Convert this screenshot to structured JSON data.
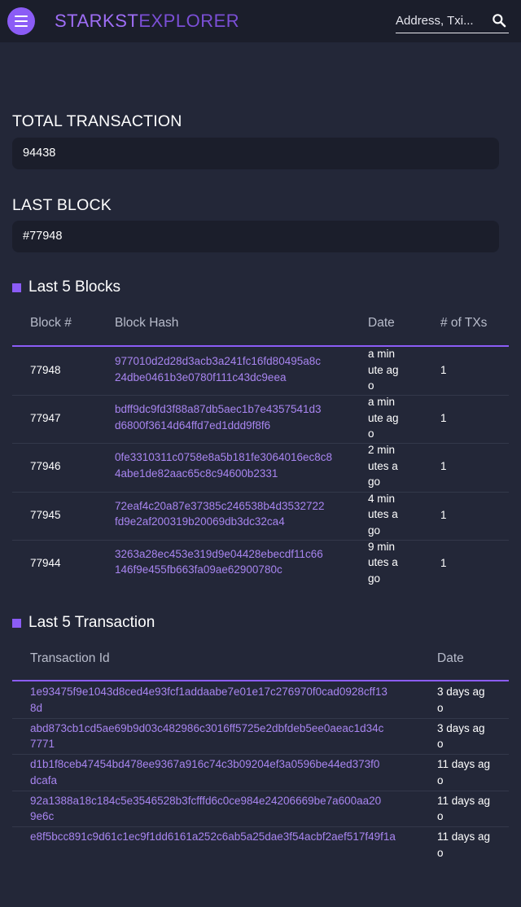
{
  "header": {
    "brand_part1": "STARKST",
    "brand_part2": "EXPLORER",
    "search_placeholder": "Address, Txi..."
  },
  "stats": {
    "total_transaction_label": "TOTAL TRANSACTION",
    "total_transaction_value": "94438",
    "last_block_label": "LAST BLOCK",
    "last_block_value": "#77948"
  },
  "blocks": {
    "title": "Last 5 Blocks",
    "columns": [
      "Block #",
      "Block Hash",
      "Date",
      "# of TXs"
    ],
    "rows": [
      {
        "number": "77948",
        "hash_line1": "977010d2d28d3acb3a241fc16fd80495a8c",
        "hash_line2": "24dbe0461b3e0780f111c43dc9eea",
        "date_l1": "a min",
        "date_l2": "ute ag",
        "date_l3": "o",
        "txs": "1"
      },
      {
        "number": "77947",
        "hash_line1": "bdff9dc9fd3f88a87db5aec1b7e4357541d3",
        "hash_line2": "d6800f3614d64ffd7ed1ddd9f8f6",
        "date_l1": "a min",
        "date_l2": "ute ag",
        "date_l3": "o",
        "txs": "1"
      },
      {
        "number": "77946",
        "hash_line1": "0fe3310311c0758e8a5b181fe3064016ec8c8",
        "hash_line2": "4abe1de82aac65c8c94600b2331",
        "date_l1": "2 min",
        "date_l2": "utes a",
        "date_l3": "go",
        "txs": "1"
      },
      {
        "number": "77945",
        "hash_line1": "72eaf4c20a87e37385c246538b4d3532722",
        "hash_line2": "fd9e2af200319b20069db3dc32ca4",
        "date_l1": "4 min",
        "date_l2": "utes a",
        "date_l3": "go",
        "txs": "1"
      },
      {
        "number": "77944",
        "hash_line1": "3263a28ec453e319d9e04428ebecdf11c66",
        "hash_line2": "146f9e455fb663fa09ae62900780c",
        "date_l1": "9 min",
        "date_l2": "utes a",
        "date_l3": "go",
        "txs": "1"
      }
    ]
  },
  "transactions": {
    "title": "Last 5 Transaction",
    "columns": [
      "Transaction Id",
      "Date"
    ],
    "rows": [
      {
        "id_line1": "1e93475f9e1043d8ced4e93fcf1addaabe7e01e17c276970f0cad0928cff13",
        "id_line2": "8d",
        "date_l1": "3 days ag",
        "date_l2": "o"
      },
      {
        "id_line1": "abd873cb1cd5ae69b9d03c482986c3016ff5725e2dbfdeb5ee0aeac1d34c",
        "id_line2": "7771",
        "date_l1": "3 days ag",
        "date_l2": "o"
      },
      {
        "id_line1": "d1b1f8ceb47454bd478ee9367a916c74c3b09204ef3a0596be44ed373f0",
        "id_line2": "dcafa",
        "date_l1": "11 days ag",
        "date_l2": "o"
      },
      {
        "id_line1": "92a1388a18c184c5e3546528b3fcfffd6c0ce984e24206669be7a600aa20",
        "id_line2": "9e6c",
        "date_l1": "11 days ag",
        "date_l2": "o"
      },
      {
        "id_line1": "e8f5bcc891c9d61c1ec9f1dd6161a252c6ab5a25dae3f54acbf2aef517f49f1a",
        "id_line2": "",
        "date_l1": "11 days ag",
        "date_l2": "o"
      }
    ]
  },
  "colors": {
    "accent": "#8b5cf6",
    "background": "#232738",
    "panel": "#1b1e2b",
    "link": "#a885f0"
  },
  "icons": {
    "menu": "menu-icon",
    "search": "search-icon"
  }
}
